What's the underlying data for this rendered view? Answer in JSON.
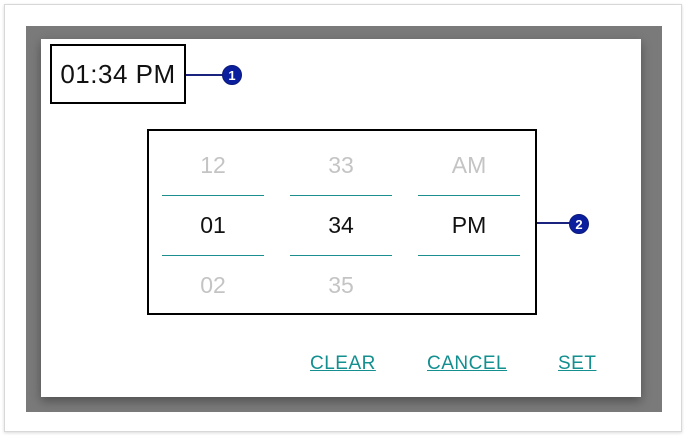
{
  "display": {
    "time": "01:34 PM"
  },
  "callouts": {
    "one": "1",
    "two": "2"
  },
  "picker": {
    "hours": {
      "prev": "12",
      "selected": "01",
      "next": "02"
    },
    "minutes": {
      "prev": "33",
      "selected": "34",
      "next": "35"
    },
    "period": {
      "prev": "AM",
      "selected": "PM",
      "next": ""
    }
  },
  "actions": {
    "clear": "CLEAR",
    "cancel": "CANCEL",
    "set": "SET"
  },
  "colors": {
    "accent": "#138f8f",
    "badge": "#0b1f9e",
    "backdrop": "#7a7a7a"
  }
}
